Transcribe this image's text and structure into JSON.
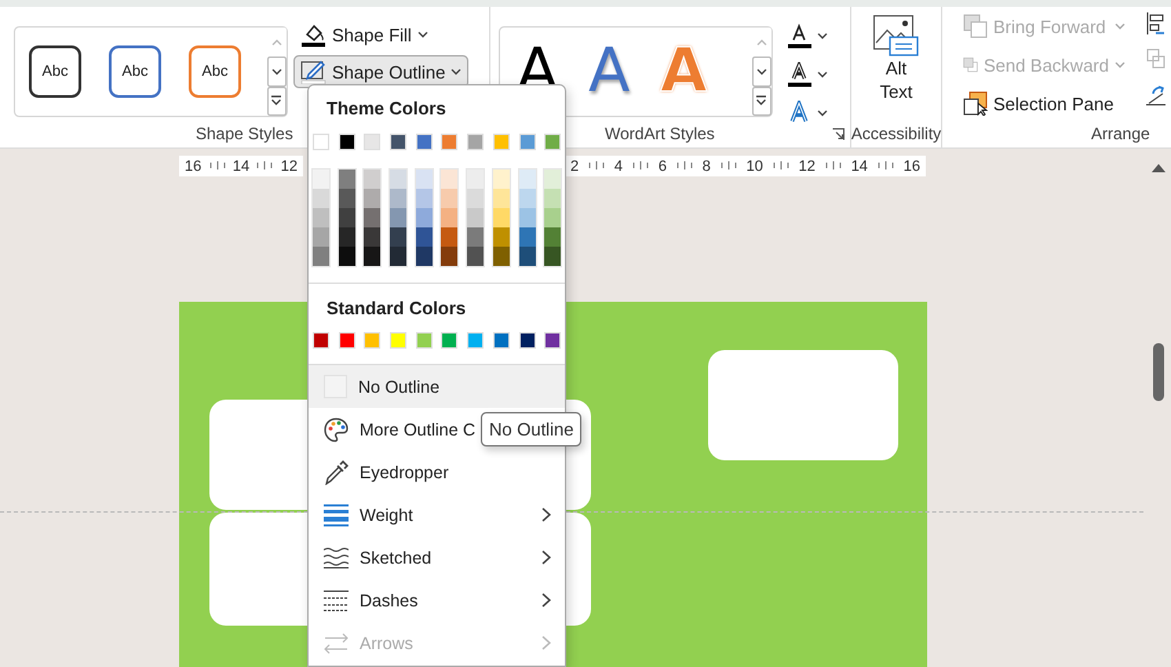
{
  "ribbon": {
    "shape_styles": {
      "label": "Shape Styles",
      "presets": [
        {
          "text": "Abc",
          "color": "#333333"
        },
        {
          "text": "Abc",
          "color": "#4472c4"
        },
        {
          "text": "Abc",
          "color": "#ed7d31"
        }
      ],
      "buttons": [
        {
          "label": "Shape Fill",
          "kind": "fill",
          "pressed": false
        },
        {
          "label": "Shape Outline",
          "kind": "outline",
          "pressed": true
        }
      ]
    },
    "wordart_styles": {
      "label": "WordArt Styles",
      "presets": [
        {
          "text": "A",
          "kind": "solid",
          "color": "#000000"
        },
        {
          "text": "A",
          "kind": "shadow",
          "color": "#4472c4"
        },
        {
          "text": "A",
          "kind": "outline",
          "color": "#ed7d31"
        }
      ]
    },
    "accessibility": {
      "label": "Accessibility",
      "button": "Alt\nText"
    },
    "arrange": {
      "label": "Arrange",
      "buttons": [
        {
          "label": "Bring Forward",
          "kind": "forward",
          "disabled": true,
          "dropdown": true
        },
        {
          "label": "Send Backward",
          "kind": "backward",
          "disabled": true,
          "dropdown": true
        },
        {
          "label": "Selection Pane",
          "kind": "pane",
          "disabled": false,
          "dropdown": false
        }
      ]
    }
  },
  "ruler": {
    "left_ticks": [
      "16",
      "14",
      "12"
    ],
    "right_ticks": [
      "2",
      "4",
      "6",
      "8",
      "10",
      "12",
      "14",
      "16"
    ]
  },
  "outline_menu": {
    "theme_title": "Theme Colors",
    "theme_colors": [
      {
        "color": "#ffffff"
      },
      {
        "color": "#000000"
      },
      {
        "color": "#e7e6e6"
      },
      {
        "color": "#44546a"
      },
      {
        "color": "#4472c4"
      },
      {
        "color": "#ed7d31"
      },
      {
        "color": "#a5a5a5"
      },
      {
        "color": "#ffc000"
      },
      {
        "color": "#5b9bd5"
      },
      {
        "color": "#70ad47"
      }
    ],
    "shades": [
      [
        {
          "color": "#f2f2f2"
        },
        {
          "color": "#d9d9d9"
        },
        {
          "color": "#bfbfbf"
        },
        {
          "color": "#a6a6a6"
        },
        {
          "color": "#808080"
        }
      ],
      [
        {
          "color": "#7f7f7f"
        },
        {
          "color": "#595959"
        },
        {
          "color": "#404040"
        },
        {
          "color": "#262626"
        },
        {
          "color": "#0d0d0d"
        }
      ],
      [
        {
          "color": "#d0cece"
        },
        {
          "color": "#aeabab"
        },
        {
          "color": "#757070"
        },
        {
          "color": "#3a3838"
        },
        {
          "color": "#171616"
        }
      ],
      [
        {
          "color": "#d6dce4"
        },
        {
          "color": "#adb9ca"
        },
        {
          "color": "#8497b0"
        },
        {
          "color": "#333f4f"
        },
        {
          "color": "#222a35"
        }
      ],
      [
        {
          "color": "#d9e2f3"
        },
        {
          "color": "#b4c6e7"
        },
        {
          "color": "#8eaadb"
        },
        {
          "color": "#2f5496"
        },
        {
          "color": "#1f3864"
        }
      ],
      [
        {
          "color": "#fbe5d5"
        },
        {
          "color": "#f7cbac"
        },
        {
          "color": "#f4b183"
        },
        {
          "color": "#c55a11"
        },
        {
          "color": "#843c0b"
        }
      ],
      [
        {
          "color": "#ededed"
        },
        {
          "color": "#dbdbdb"
        },
        {
          "color": "#c9c9c9"
        },
        {
          "color": "#7b7b7b"
        },
        {
          "color": "#525252"
        }
      ],
      [
        {
          "color": "#fff2cc"
        },
        {
          "color": "#fee599"
        },
        {
          "color": "#ffd966"
        },
        {
          "color": "#bf9000"
        },
        {
          "color": "#7f6000"
        }
      ],
      [
        {
          "color": "#deebf6"
        },
        {
          "color": "#bdd7ee"
        },
        {
          "color": "#9cc3e5"
        },
        {
          "color": "#2e75b5"
        },
        {
          "color": "#1e4e79"
        }
      ],
      [
        {
          "color": "#e2efd9"
        },
        {
          "color": "#c5e0b3"
        },
        {
          "color": "#a8d08d"
        },
        {
          "color": "#538135"
        },
        {
          "color": "#375623"
        }
      ]
    ],
    "standard_title": "Standard Colors",
    "standard_colors": [
      {
        "color": "#c00000"
      },
      {
        "color": "#ff0000"
      },
      {
        "color": "#ffc000"
      },
      {
        "color": "#ffff00"
      },
      {
        "color": "#92d050"
      },
      {
        "color": "#00b050"
      },
      {
        "color": "#00b0f0"
      },
      {
        "color": "#0070c0"
      },
      {
        "color": "#002060"
      },
      {
        "color": "#7030a0"
      }
    ],
    "items": [
      {
        "label": "No Outline",
        "kind": "none",
        "highlighted": true,
        "submenu": false,
        "disabled": false
      },
      {
        "label": "More Outline C",
        "kind": "palette",
        "highlighted": false,
        "submenu": false,
        "disabled": false
      },
      {
        "label": "Eyedropper",
        "kind": "eyedropper",
        "highlighted": false,
        "submenu": false,
        "disabled": false
      },
      {
        "label": "Weight",
        "kind": "weight",
        "highlighted": false,
        "submenu": true,
        "disabled": false
      },
      {
        "label": "Sketched",
        "kind": "sketched",
        "highlighted": false,
        "submenu": true,
        "disabled": false
      },
      {
        "label": "Dashes",
        "kind": "dashes",
        "highlighted": false,
        "submenu": true,
        "disabled": false
      },
      {
        "label": "Arrows",
        "kind": "arrows",
        "highlighted": false,
        "submenu": true,
        "disabled": true
      }
    ]
  },
  "tooltip": {
    "text": "No Outline"
  }
}
